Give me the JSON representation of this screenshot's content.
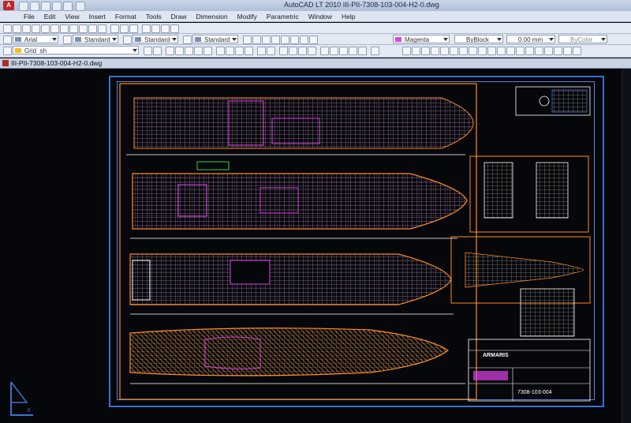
{
  "window": {
    "title": "AutoCAD LT 2010   III-PII-7308-103-004-H2-0.dwg"
  },
  "menu": [
    "File",
    "Edit",
    "View",
    "Insert",
    "Format",
    "Tools",
    "Draw",
    "Dimension",
    "Modify",
    "Parametric",
    "Window",
    "Help"
  ],
  "toolbar_styles": {
    "text_style": "Arial",
    "dim_style": "Standard",
    "table_style": "Standard",
    "multileader_style": "Standard",
    "color": "Magenta",
    "linetype": "ByBlock",
    "lineweight": "0.00 mm",
    "plot_style": "ByColor"
  },
  "layer_combo": "Grid_sh",
  "document": {
    "tab_label": "III-PII-7308-103-004-H2-0.dwg"
  },
  "drawing": {
    "title_block": "ARMARIS",
    "drawing_number": "7308-103-004"
  },
  "colors": {
    "ui_bg": "#e4eaf3",
    "canvas": "#05070a",
    "frame": "#3c6fd0",
    "hull_outline": "#ff8a1f",
    "structure": "#e040e8",
    "grid": "#ffffff"
  }
}
